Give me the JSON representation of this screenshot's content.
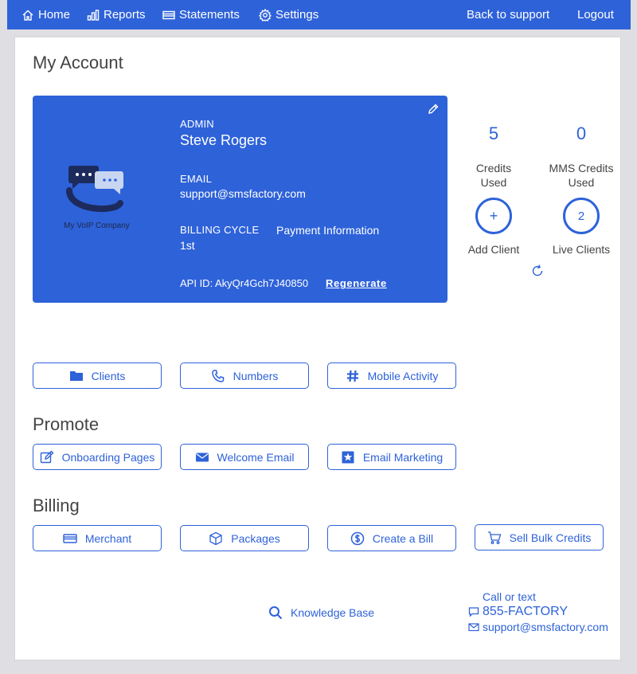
{
  "nav": {
    "home": "Home",
    "reports": "Reports",
    "statements": "Statements",
    "settings": "Settings",
    "back": "Back to support",
    "logout": "Logout"
  },
  "page": {
    "title": "My Account"
  },
  "account": {
    "role": "ADMIN",
    "name": "Steve Rogers",
    "email_label": "EMAIL",
    "email": "support@smsfactory.com",
    "billing_label": "BILLING CYCLE",
    "billing_value": "1st",
    "payment_label": "Payment Information",
    "api_label": "API ID:",
    "api_id": "AkyQr4Gch7J40850",
    "regenerate": "Regenerate",
    "logo_caption": "My VoIP Company"
  },
  "stats": {
    "credits_used_value": "5",
    "credits_used_label": "Credits Used",
    "mms_value": "0",
    "mms_label": "MMS Credits Used",
    "add_client_symbol": "+",
    "add_client_label": "Add Client",
    "live_clients_value": "2",
    "live_clients_label": "Live Clients"
  },
  "manage": {
    "clients": "Clients",
    "numbers": "Numbers",
    "mobile": "Mobile Activity"
  },
  "promote": {
    "title": "Promote",
    "onboarding": "Onboarding Pages",
    "welcome": "Welcome Email",
    "marketing": "Email Marketing"
  },
  "billing": {
    "title": "Billing",
    "merchant": "Merchant",
    "packages": "Packages",
    "create_bill": "Create a Bill",
    "bulk": "Sell Bulk Credits"
  },
  "footer": {
    "kb": "Knowledge Base",
    "call_label": "Call or text",
    "phone": "855-FACTORY",
    "email": "support@smsfactory.com"
  },
  "colors": {
    "primary": "#2e62d9",
    "background": "#dedee3",
    "text": "#444444"
  }
}
